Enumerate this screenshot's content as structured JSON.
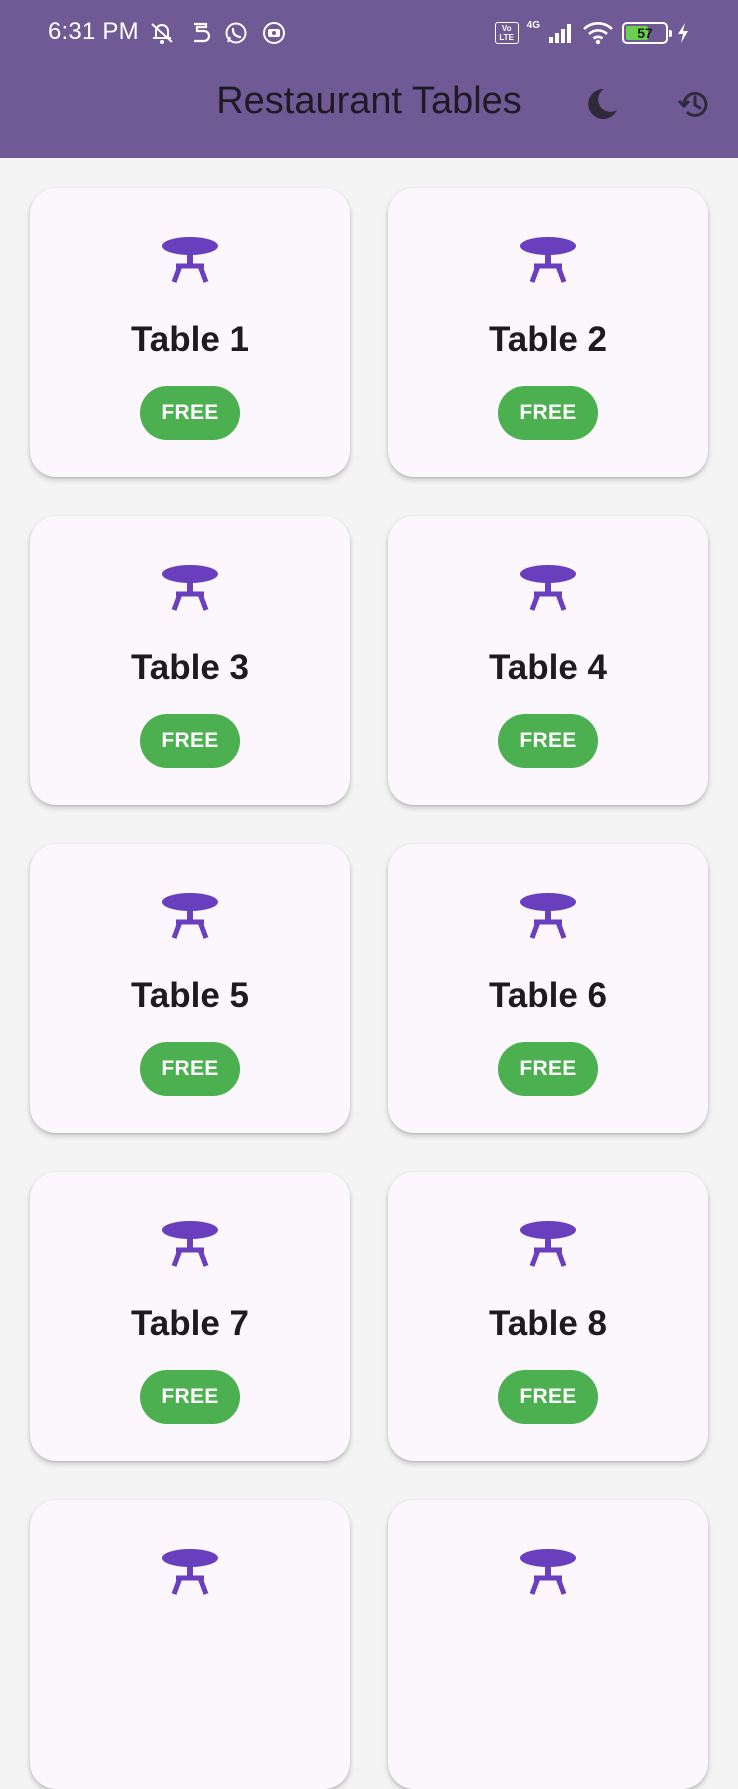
{
  "status_bar": {
    "time": "6:31 PM",
    "network": "4G",
    "volte": [
      "Vo",
      "LTE"
    ],
    "battery": "57"
  },
  "app_bar": {
    "title": "Restaurant Tables",
    "theme_icon": "dark-mode-moon-icon",
    "history_icon": "history-icon",
    "background_color": "#6f5a95"
  },
  "colors": {
    "table_icon": "#6a3fbd",
    "free_badge": "#4caf50",
    "card_background": "#fcf6fd"
  },
  "tables": [
    {
      "name": "Table 1",
      "status": "FREE"
    },
    {
      "name": "Table 2",
      "status": "FREE"
    },
    {
      "name": "Table 3",
      "status": "FREE"
    },
    {
      "name": "Table 4",
      "status": "FREE"
    },
    {
      "name": "Table 5",
      "status": "FREE"
    },
    {
      "name": "Table 6",
      "status": "FREE"
    },
    {
      "name": "Table 7",
      "status": "FREE"
    },
    {
      "name": "Table 8",
      "status": "FREE"
    },
    {
      "name": "",
      "status": ""
    },
    {
      "name": "",
      "status": ""
    }
  ]
}
